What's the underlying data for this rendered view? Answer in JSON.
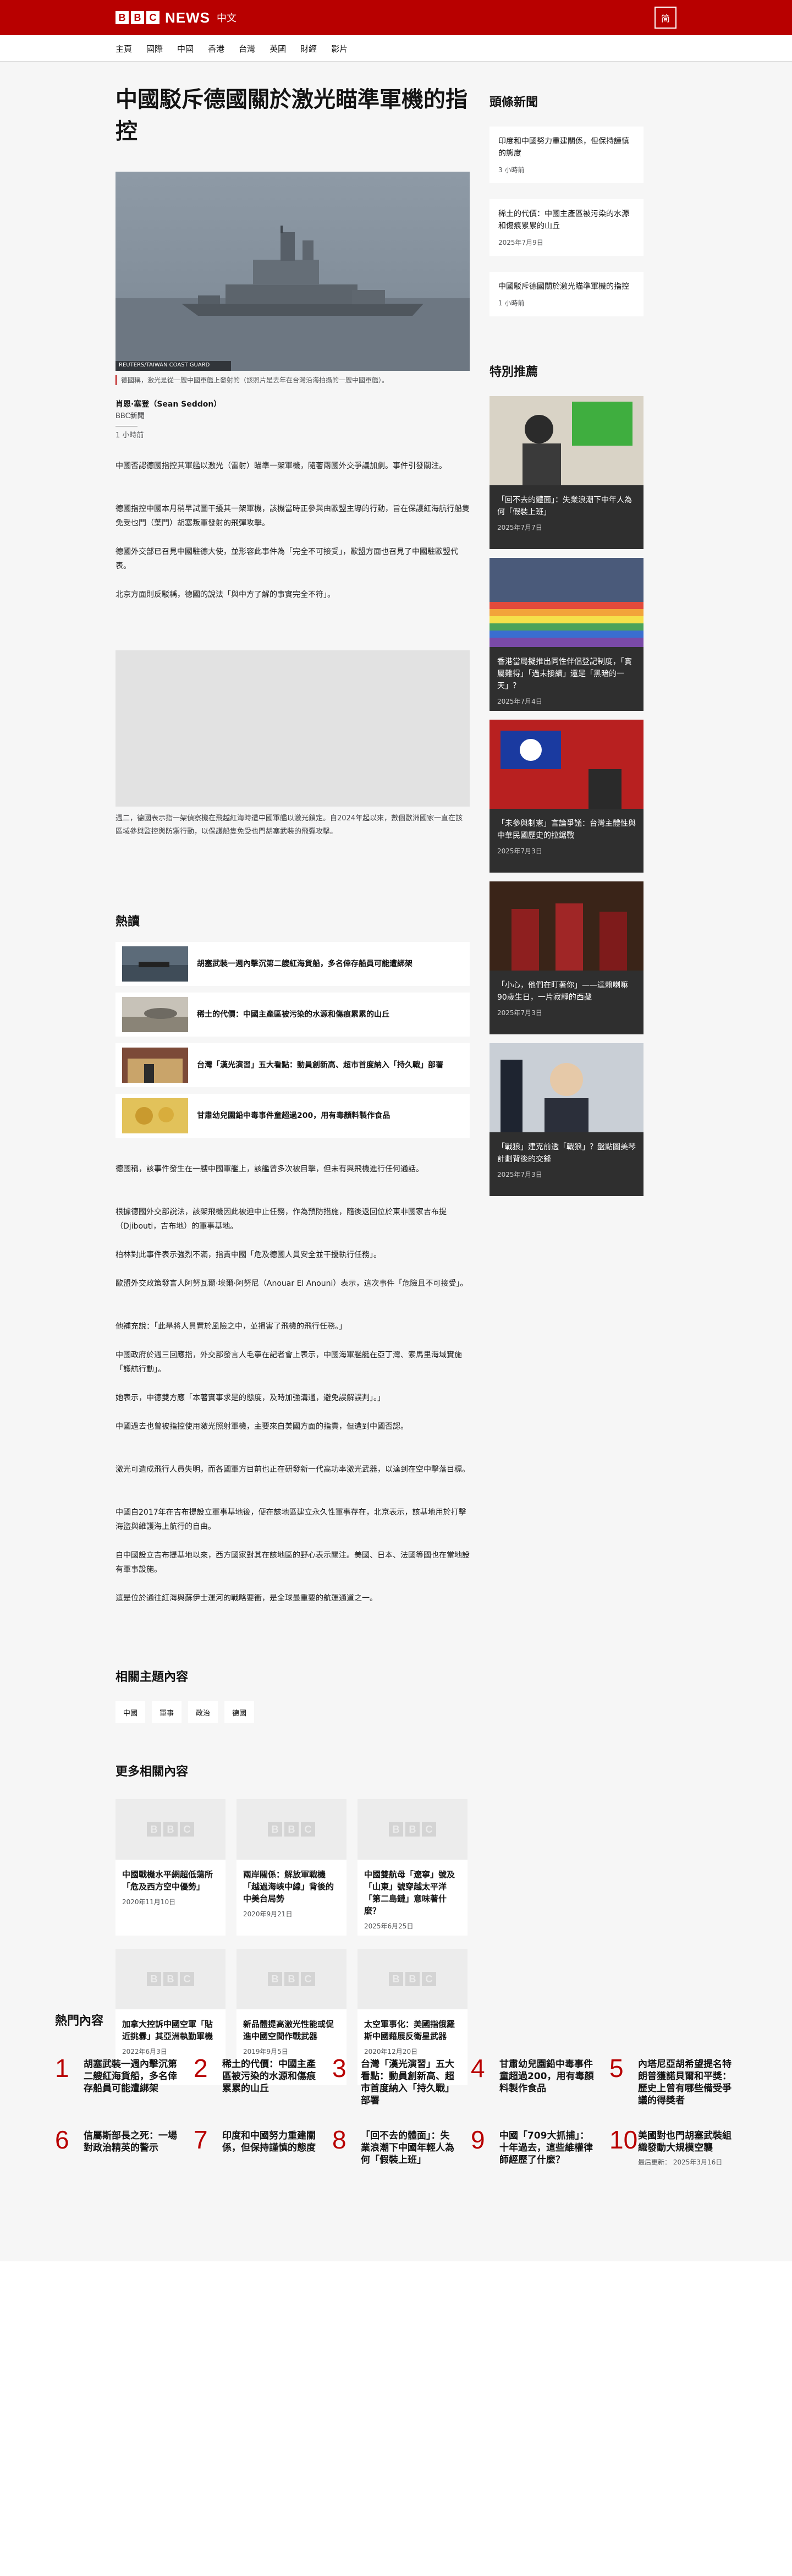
{
  "header": {
    "logo_letters": [
      "B",
      "B",
      "C"
    ],
    "brand": "NEWS",
    "brand_cn": "中文",
    "lang_button": "简"
  },
  "nav": [
    "主頁",
    "國際",
    "中國",
    "香港",
    "台灣",
    "英國",
    "財經",
    "影片"
  ],
  "article": {
    "title": "中國駁斥德國關於激光瞄準軍機的指控",
    "image_credit": "REUTERS/TAIWAN COAST GUARD",
    "caption": "德國稱，激光是從一艘中國軍艦上發射的（該照片是去年在台灣沿海拍攝的一艘中國軍艦）。",
    "author": "肖恩·塞登（Sean Seddon）",
    "org": "BBC新聞",
    "time": "1 小時前",
    "paras_top": [
      "中國否認德國指控其軍艦以激光（雷射）瞄準一架軍機，隨著兩國外交爭議加劇。事件引發關注。",
      "德國指控中國本月稍早試圖干擾其一架軍機，該機當時正參與由歐盟主導的行動，旨在保護紅海航行船隻免受也門（葉門）胡塞叛軍發射的飛彈攻擊。",
      "德國外交部已召見中國駐德大使，並形容此事件為「完全不可接受」，歐盟方面也召見了中國駐歐盟代表。",
      "北京方面則反駁稱，德國的說法「與中方了解的事實完全不符」。"
    ],
    "video_caption": "週二，德國表示指一架偵察機在飛越紅海時遭中國軍艦以激光鎖定。自2024年起以來，數個歐洲國家一直在該區域參與監控與防禦行動，以保護船隻免受也門胡塞武裝的飛彈攻擊。",
    "paras_bottom": [
      "德國稱，該事件發生在一艘中國軍艦上，該艦曾多次被目擊，但未有與飛機進行任何通話。",
      "根據德國外交部說法，該架飛機因此被迫中止任務，作為預防措施，隨後返回位於東非國家吉布提（Djibouti，吉布地）的軍事基地。",
      "柏林對此事件表示強烈不滿，指責中國「危及德國人員安全並干擾執行任務」。",
      "歐盟外交政策發言人阿努瓦爾·埃爾·阿努尼（Anouar El Anouni）表示，這次事件「危險且不可接受」。",
      "他補充說：「此舉將人員置於風險之中，並損害了飛機的飛行任務。」",
      "中國政府於週三回應指，外交部發言人毛寧在記者會上表示，中國海軍艦艇在亞丁灣、索馬里海域實施「護航行動」。",
      "她表示，中德雙方應「本著實事求是的態度，及時加強溝通，避免誤解誤判」。」",
      "中國過去也曾被指控使用激光照射軍機，主要來自美國方面的指責，但遭到中國否認。",
      "激光可造成飛行人員失明，而各國軍方目前也正在研發新一代高功率激光武器，以達到在空中擊落目標。",
      "中國自2017年在吉布提設立軍事基地後，便在該地區建立永久性軍事存在，北京表示，該基地用於打擊海盜與維護海上航行的自由。",
      "自中國設立吉布提基地以來，西方國家對其在該地區的野心表示關注。美國、日本、法國等國也在當地設有軍事設施。",
      "這是位於通往紅海與蘇伊士運河的戰略要衝，是全球最重要的航運通道之一。"
    ]
  },
  "hot": {
    "title": "熱讀",
    "items": [
      "胡塞武裝一週內擊沉第二艘紅海貨船，多名倖存船員可能遭綁架",
      "稀土的代價：中國主產區被污染的水源和傷痕累累的山丘",
      "台灣「漢光演習」五大看點：動員創新高、超市首度納入「持久戰」部署",
      "甘肅幼兒園鉛中毒事件童超過200，用有毒顏料製作食品"
    ]
  },
  "topics": {
    "title": "相關主題內容",
    "tags": [
      "中國",
      "軍事",
      "政治",
      "德國"
    ]
  },
  "more": {
    "title": "更多相關內容",
    "cards": [
      {
        "title": "中國戰機水平網超低蕩所「危及西方空中優勢」",
        "date": "2020年11月10日"
      },
      {
        "title": "兩岸關係：解放軍戰機「越過海峽中線」背後的中美台局勢",
        "date": "2020年9月21日"
      },
      {
        "title": "中國雙航母「遼寧」號及「山東」號穿越太平洋「第二島鏈」意味著什麼？",
        "date": "2025年6月25日"
      },
      {
        "title": "加拿大控訴中國空軍「貼近挑釁」其亞洲執勤軍機",
        "date": "2022年6月3日"
      },
      {
        "title": "新品體提高激光性能或促進中國空間作戰武器",
        "date": "2019年9月5日"
      },
      {
        "title": "太空軍事化：美國指俄羅斯中國藉展反衛星武器",
        "date": "2020年12月20日"
      }
    ]
  },
  "sidebar": {
    "top_title": "頭條新聞",
    "top": [
      {
        "title": "印度和中國努力重建關係，但保持謹慎的態度",
        "time": "3 小時前"
      },
      {
        "title": "稀土的代價：中國主產區被污染的水源和傷痕累累的山丘",
        "time": "2025年7月9日"
      },
      {
        "title": "中國駁斥德國關於激光瞄準軍機的指控",
        "time": "1 小時前"
      }
    ],
    "featured_title": "特別推薦",
    "featured": [
      {
        "title": "「回不去的體面」：失業浪潮下中年人為何「假裝上班」",
        "date": "2025年7月7日"
      },
      {
        "title": "香港當局擬推出同性伴侶登記制度，「實屬難得」「過未接續」還是「黑暗的一天」？",
        "date": "2025年7月4日"
      },
      {
        "title": "「未參與制憲」言論爭議：台灣主體性與中華民國歷史的拉鋸戰",
        "date": "2025年7月3日"
      },
      {
        "title": "「小心，他們在盯著你」——達賴喇嘛90歲生日，一片寂靜的西藏",
        "date": "2025年7月3日"
      },
      {
        "title": "「戰狼」建克前透「戰狼」？盤點圖美琴計劃背後的交鋒",
        "date": "2025年7月3日"
      }
    ]
  },
  "mostread": {
    "title": "熱門內容",
    "items": [
      "胡塞武裝一週內擊沉第二艘紅海貨船，多名倖存船員可能遭綁架",
      "稀土的代價：中國主產區被污染的水源和傷痕累累的山丘",
      "台灣「漢光演習」五大看點：動員創新高、超市首度納入「持久戰」部署",
      "甘肅幼兒園鉛中毒事件童超過200，用有毒顏料製作食品",
      "內塔尼亞胡希望提名特朗普獲諾貝爾和平獎：歷史上曾有哪些備受爭議的得獎者",
      "信屬斯部長之死：一場對政治精英的警示",
      "印度和中國努力重建關係，但保持謹慎的態度",
      "「回不去的體面」：失業浪潮下中國年輕人為何「假裝上班」",
      "中國「709大抓捕」：十年過去，這些維權律師經歷了什麼？",
      "美國對也門胡塞武裝組織發動大規模空襲"
    ],
    "numbers": [
      "1",
      "2",
      "3",
      "4",
      "5",
      "6",
      "7",
      "8",
      "9",
      "10"
    ],
    "updated": "最后更新： 2025年3月16日"
  },
  "colors": {
    "brand_red": "#b80000",
    "page_bg": "#f6f6f6",
    "card_bg": "#ffffff",
    "featured_bg": "#2f2f2f"
  },
  "icons": [
    "bbc-logo",
    "lang-toggle"
  ]
}
